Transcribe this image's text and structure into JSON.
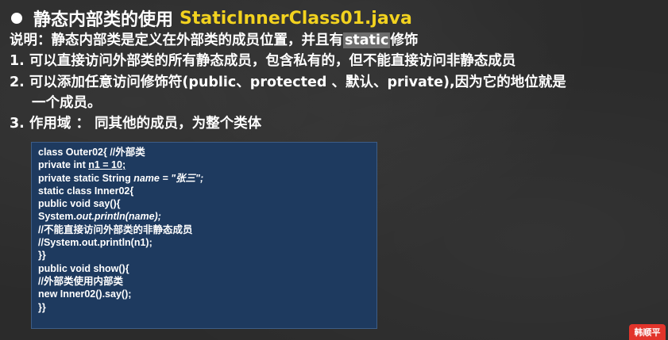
{
  "title": {
    "cn": "静态内部类的使用",
    "file": "StaticInnerClass01.java"
  },
  "explain": {
    "prefix": "说明：静态内部类是定义在外部类的成员位置，并且有",
    "keyword": "static",
    "suffix": "修饰"
  },
  "points": {
    "p1": "1. 可以直接访问外部类的所有静态成员，包含私有的，但不能直接访问非静态成员",
    "p2a": "2. 可以添加任意访问修饰符(public、protected 、默认、private),因为它的地位就是",
    "p2b": "一个成员。",
    "p3": "3. 作用域 ： 同其他的成员，为整个类体"
  },
  "code": {
    "l1": "class Outer02{ //外部类",
    "l2a": "private int ",
    "l2b": "n1",
    "l2c": " = 10;",
    "l3a": "private static String ",
    "l3b": "name = \"张三\";",
    "l4": "static class Inner02{",
    "l5": "public void say(){",
    "l6a": "System.",
    "l6b": "out.println(name);",
    "l7": "//不能直接访问外部类的非静态成员",
    "l8": "//System.out.println(n1);",
    "l9": "}}",
    "l10": "public void show(){",
    "l11": "//外部类使用内部类",
    "l12": "new Inner02().say();",
    "l13": "}}"
  },
  "logo": {
    "text": "韩顺平"
  }
}
